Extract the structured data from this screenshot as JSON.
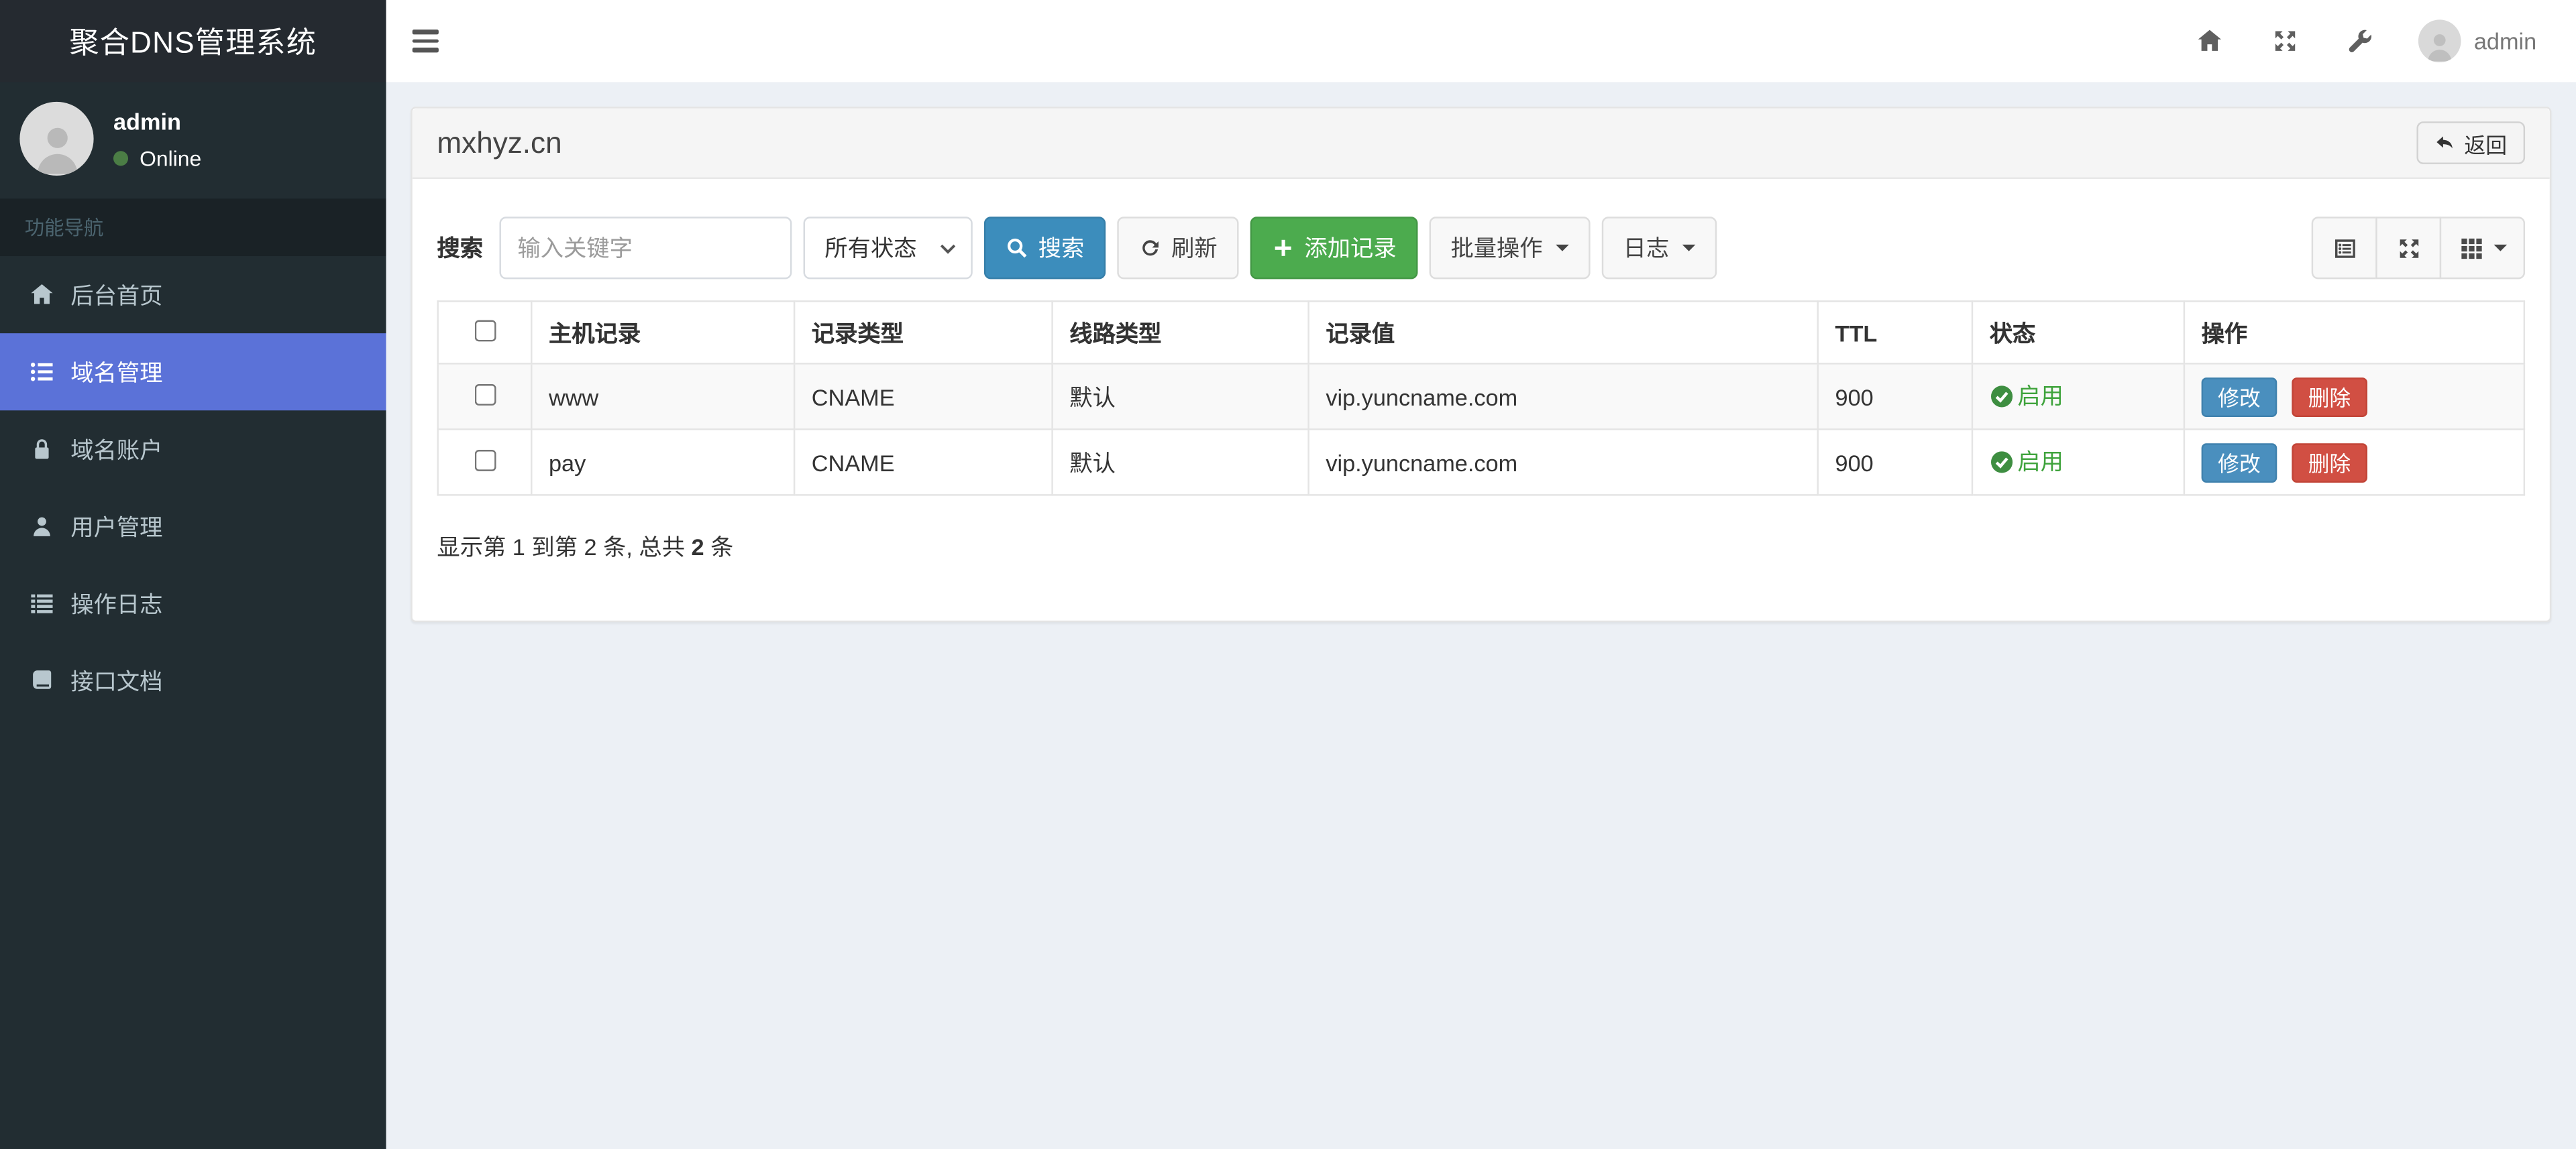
{
  "app": {
    "title": "聚合DNS管理系统"
  },
  "sidebar": {
    "user": {
      "name": "admin",
      "status": "Online"
    },
    "nav_header": "功能导航",
    "items": [
      {
        "label": "后台首页",
        "icon": "home-icon",
        "active": false
      },
      {
        "label": "域名管理",
        "icon": "list-icon",
        "active": true
      },
      {
        "label": "域名账户",
        "icon": "lock-icon",
        "active": false
      },
      {
        "label": "用户管理",
        "icon": "user-icon",
        "active": false
      },
      {
        "label": "操作日志",
        "icon": "log-icon",
        "active": false
      },
      {
        "label": "接口文档",
        "icon": "book-icon",
        "active": false
      }
    ]
  },
  "navbar": {
    "icons": [
      "home-icon",
      "fullscreen-icon",
      "wrench-icon"
    ],
    "username": "admin"
  },
  "panel": {
    "title": "mxhyz.cn",
    "back_button": "返回"
  },
  "toolbar": {
    "search_label": "搜索",
    "search_placeholder": "输入关键字",
    "status_filter_value": "所有状态",
    "search_button": "搜索",
    "refresh_button": "刷新",
    "add_button": "添加记录",
    "batch_button": "批量操作",
    "log_button": "日志",
    "view_icons": [
      "list-alt-icon",
      "fullscreen-icon",
      "columns-grid-icon"
    ]
  },
  "table": {
    "columns": {
      "host": "主机记录",
      "type": "记录类型",
      "line": "线路类型",
      "value": "记录值",
      "ttl": "TTL",
      "status": "状态",
      "actions": "操作"
    },
    "rows": [
      {
        "host": "www",
        "type": "CNAME",
        "line": "默认",
        "value": "vip.yuncname.com",
        "ttl": "900",
        "status": "启用"
      },
      {
        "host": "pay",
        "type": "CNAME",
        "line": "默认",
        "value": "vip.yuncname.com",
        "ttl": "900",
        "status": "启用"
      }
    ],
    "row_actions": {
      "edit": "修改",
      "delete": "删除"
    },
    "summary": {
      "prefix": "显示第 1 到第 2 条, 总共 ",
      "total": "2",
      "suffix": " 条"
    }
  },
  "colors": {
    "sidebar_bg": "#222d32",
    "sidebar_active": "#5b72d8",
    "primary_button": "#3c8dbc",
    "success_button": "#4cab4e",
    "edit_button": "#4a8fbe",
    "delete_button": "#d14f43",
    "status_enabled_green": "#3fa33c",
    "online_dot": "#4b7d45"
  }
}
